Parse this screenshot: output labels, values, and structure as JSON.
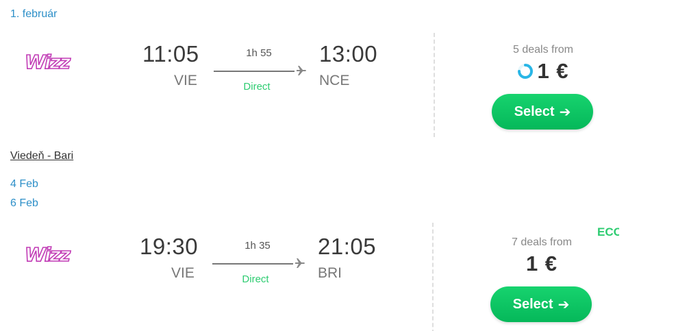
{
  "dates": {
    "top_date": "1. február",
    "date_1": "4 Feb",
    "date_2": "6 Feb"
  },
  "route_title": "Viedeň - Bari",
  "flights": [
    {
      "airline": "Wizz",
      "depart_time": "11:05",
      "depart_airport": "VIE",
      "duration": "1h 55",
      "stops": "Direct",
      "arrive_time": "13:00",
      "arrive_airport": "NCE",
      "deals": "5 deals from",
      "price": "1 €",
      "select_label": "Select",
      "loading": true
    },
    {
      "airline": "Wizz",
      "depart_time": "19:30",
      "depart_airport": "VIE",
      "duration": "1h 35",
      "stops": "Direct",
      "arrive_time": "21:05",
      "arrive_airport": "BRI",
      "deals": "7 deals from",
      "price": "1 €",
      "select_label": "Select",
      "badge": "ECO",
      "loading": false
    }
  ],
  "icons": {
    "airline_logo": "wizz-logo",
    "plane": "plane-icon",
    "arrow": "arrow-right-icon",
    "spinner": "loading-spinner-icon"
  },
  "colors": {
    "link": "#2d8fc8",
    "green": "#2ecc71",
    "button": "#05b85a",
    "logo_purple": "#c13bb5"
  }
}
